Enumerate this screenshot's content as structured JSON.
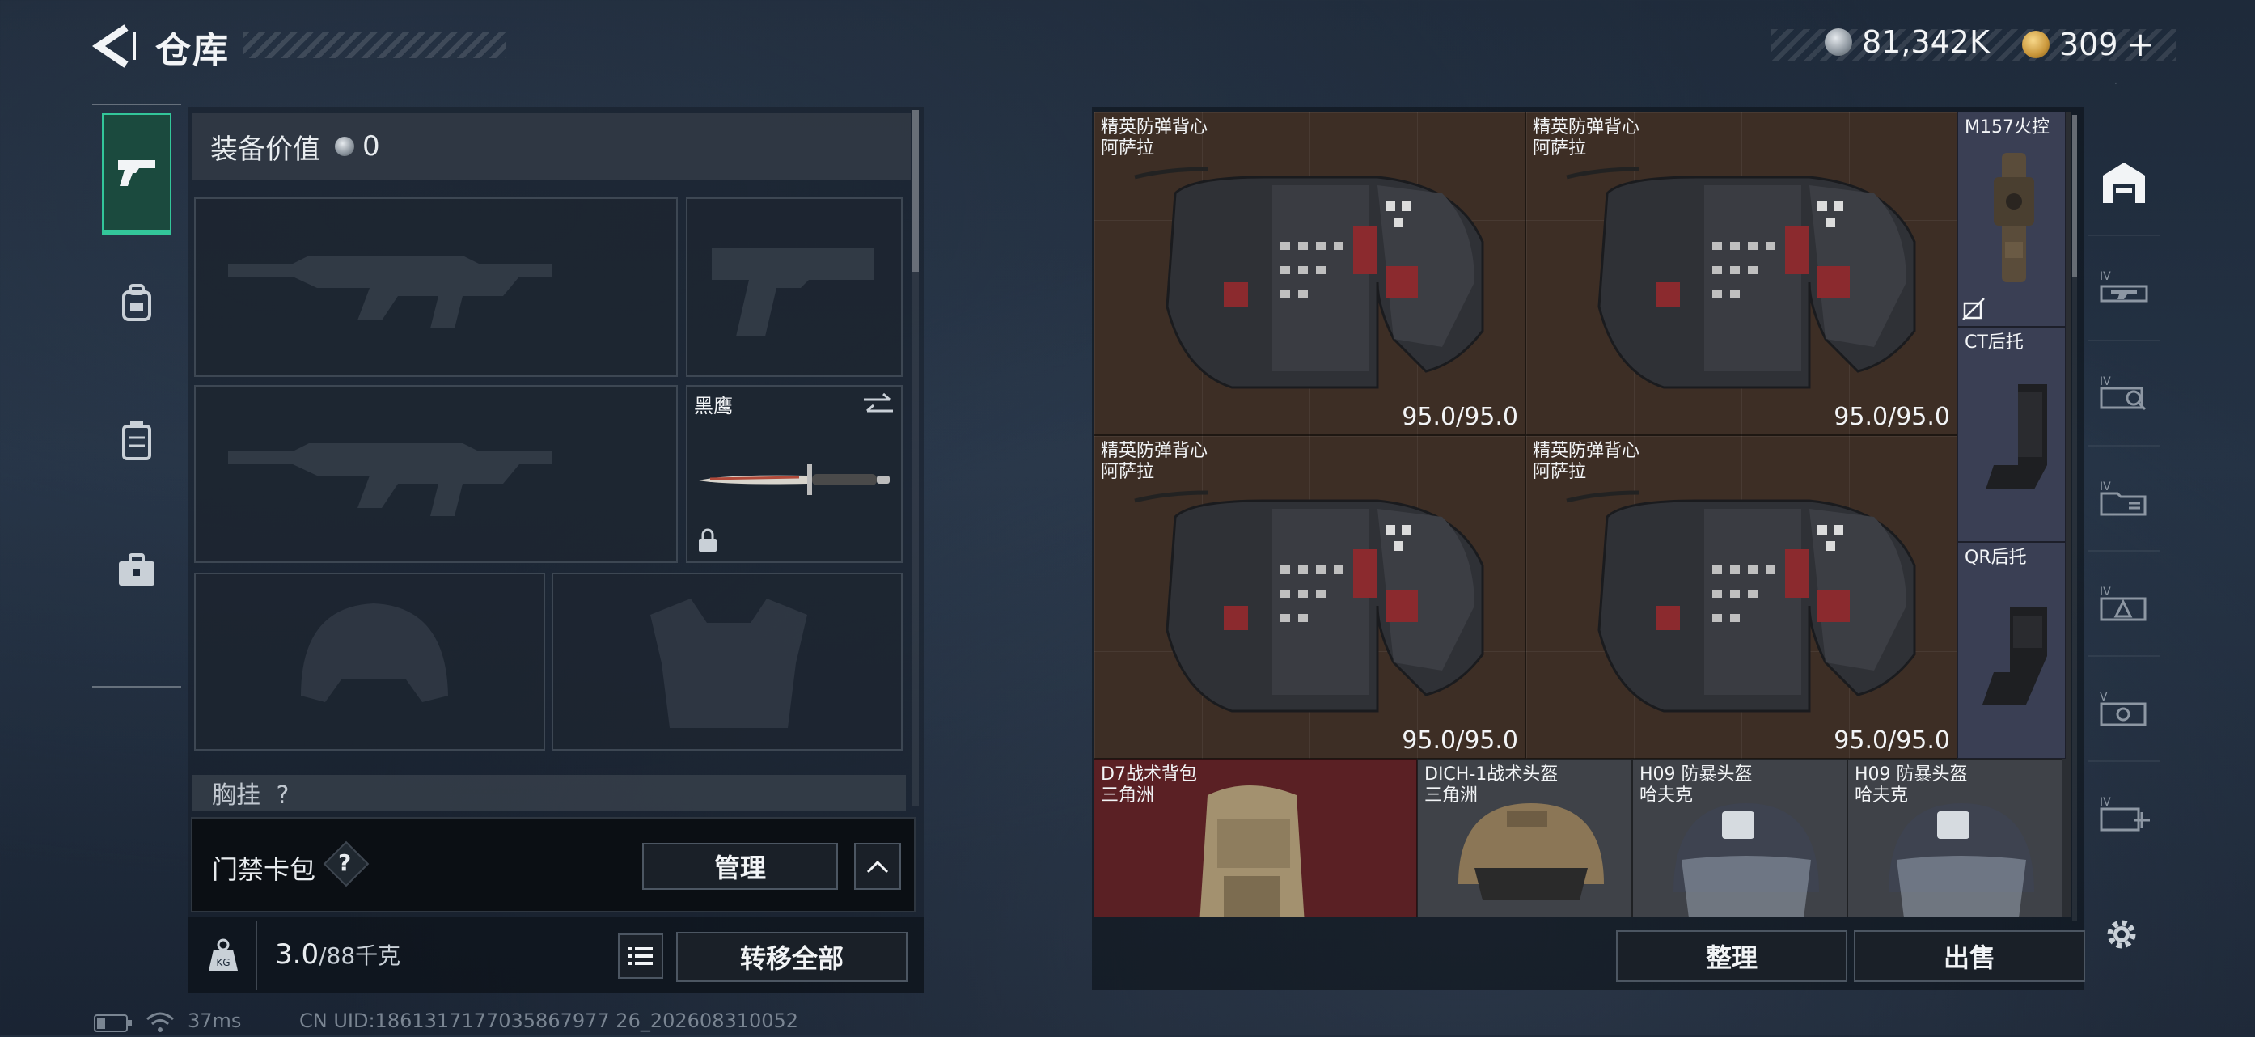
{
  "header": {
    "title": "仓库"
  },
  "currencies": [
    {
      "icon": "silver-coin-icon",
      "value": "81,342K"
    },
    {
      "icon": "gold-coin-icon",
      "value": "309"
    }
  ],
  "left_sidebar": {
    "tabs": [
      {
        "name": "pistol-icon",
        "active": true
      },
      {
        "name": "backpack-icon",
        "active": false
      },
      {
        "name": "locker-icon",
        "active": false
      },
      {
        "name": "briefcase-icon",
        "active": false
      }
    ]
  },
  "loadout": {
    "equip_value_label": "装备价值",
    "equip_value": "0",
    "melee_slot_name": "黑鹰",
    "chest_label": "胸挂"
  },
  "keycard": {
    "label": "门禁卡包",
    "help": "?",
    "manage_button": "管理"
  },
  "weight": {
    "icon": "kg-weight-icon",
    "current": "3.0",
    "max_label": "/88千克",
    "transfer_all_button": "转移全部"
  },
  "storage": {
    "items": [
      {
        "name": "精英防弹背心",
        "subtitle": "阿萨拉",
        "durability": "95.0/95.0"
      },
      {
        "name": "精英防弹背心",
        "subtitle": "阿萨拉",
        "durability": "95.0/95.0"
      },
      {
        "name": "精英防弹背心",
        "subtitle": "阿萨拉",
        "durability": "95.0/95.0"
      },
      {
        "name": "精英防弹背心",
        "subtitle": "阿萨拉",
        "durability": "95.0/95.0"
      },
      {
        "name": "M157火控",
        "subtitle": ""
      },
      {
        "name": "CT后托",
        "subtitle": ""
      },
      {
        "name": "QR后托",
        "subtitle": ""
      },
      {
        "name": "D7战术背包",
        "subtitle": "三角洲"
      },
      {
        "name": "DICH-1战术头盔",
        "subtitle": "三角洲"
      },
      {
        "name": "H09 防暴头盔",
        "subtitle": "哈夫克"
      },
      {
        "name": "H09 防暴头盔",
        "subtitle": "哈夫克"
      }
    ],
    "sort_button": "整理",
    "sell_button": "出售"
  },
  "status_bar": {
    "ping": "37ms",
    "uid": "CN UID:1861317177035867977 26_202608310052"
  },
  "colors": {
    "accent": "#33c69a",
    "item_brown": "#3d2e25",
    "item_blue": "#3a3f54",
    "item_red": "#5a2024"
  }
}
